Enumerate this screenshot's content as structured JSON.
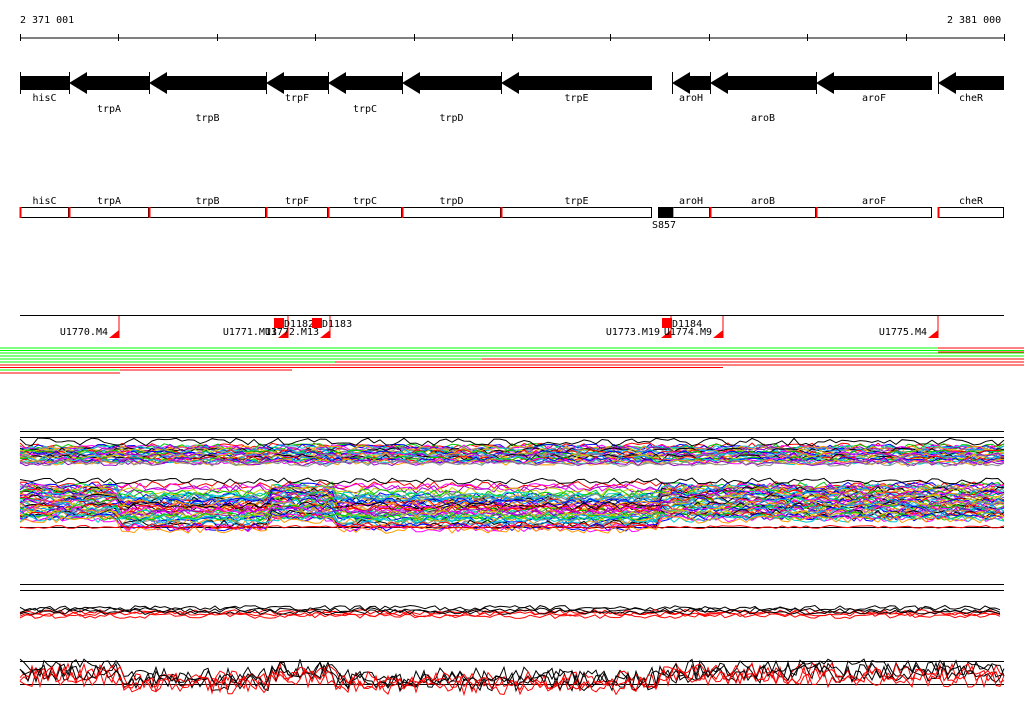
{
  "ruler": {
    "start_label": "2 371 001",
    "end_label": "2 381 000"
  },
  "genes": [
    {
      "name": "hisC",
      "start": 20,
      "end": 69,
      "row": 0
    },
    {
      "name": "trpA",
      "start": 69,
      "end": 149,
      "row": 1
    },
    {
      "name": "trpB",
      "start": 149,
      "end": 266,
      "row": 2
    },
    {
      "name": "trpF",
      "start": 266,
      "end": 328,
      "row": 0
    },
    {
      "name": "trpC",
      "start": 328,
      "end": 402,
      "row": 1
    },
    {
      "name": "trpD",
      "start": 402,
      "end": 501,
      "row": 2
    },
    {
      "name": "trpE",
      "start": 501,
      "end": 652,
      "row": 0
    },
    {
      "name": "aroH",
      "start": 672,
      "end": 710,
      "row": 0
    },
    {
      "name": "aroB",
      "start": 710,
      "end": 816,
      "row": 2
    },
    {
      "name": "aroF",
      "start": 816,
      "end": 932,
      "row": 0
    },
    {
      "name": "cheR",
      "start": 938,
      "end": 1004,
      "row": 0
    }
  ],
  "feature_boxes": [
    "hisC",
    "trpA",
    "trpB",
    "trpF",
    "trpC",
    "trpD",
    "trpE",
    "aroH",
    "aroB",
    "aroF",
    "cheR"
  ],
  "site": {
    "label": "S857"
  },
  "transcripts": [
    {
      "label": "U1770.M4",
      "pos": 119
    },
    {
      "label": "U1771.M13",
      "pos": 288
    },
    {
      "label": "U1772.M13",
      "pos": 330
    },
    {
      "label": "U1773.M19",
      "pos": 671
    },
    {
      "label": "U1774.M9",
      "pos": 723
    },
    {
      "label": "U1775.M4",
      "pos": 938
    }
  ],
  "down_markers": [
    {
      "label": "D1182",
      "pos": 276
    },
    {
      "label": "D1183",
      "pos": 314
    },
    {
      "label": "D1184",
      "pos": 664
    }
  ],
  "colors": {
    "gene": "#000000",
    "feature_edge": "#ff0000",
    "up": "#00ff00",
    "down": "#ff0000",
    "line_palette": [
      "#ff0000",
      "#00cc00",
      "#0000ff",
      "#ff00ff",
      "#00cccc",
      "#ff9900",
      "#9900cc",
      "#888888",
      "#000000",
      "#cccc00",
      "#0099ff"
    ]
  }
}
